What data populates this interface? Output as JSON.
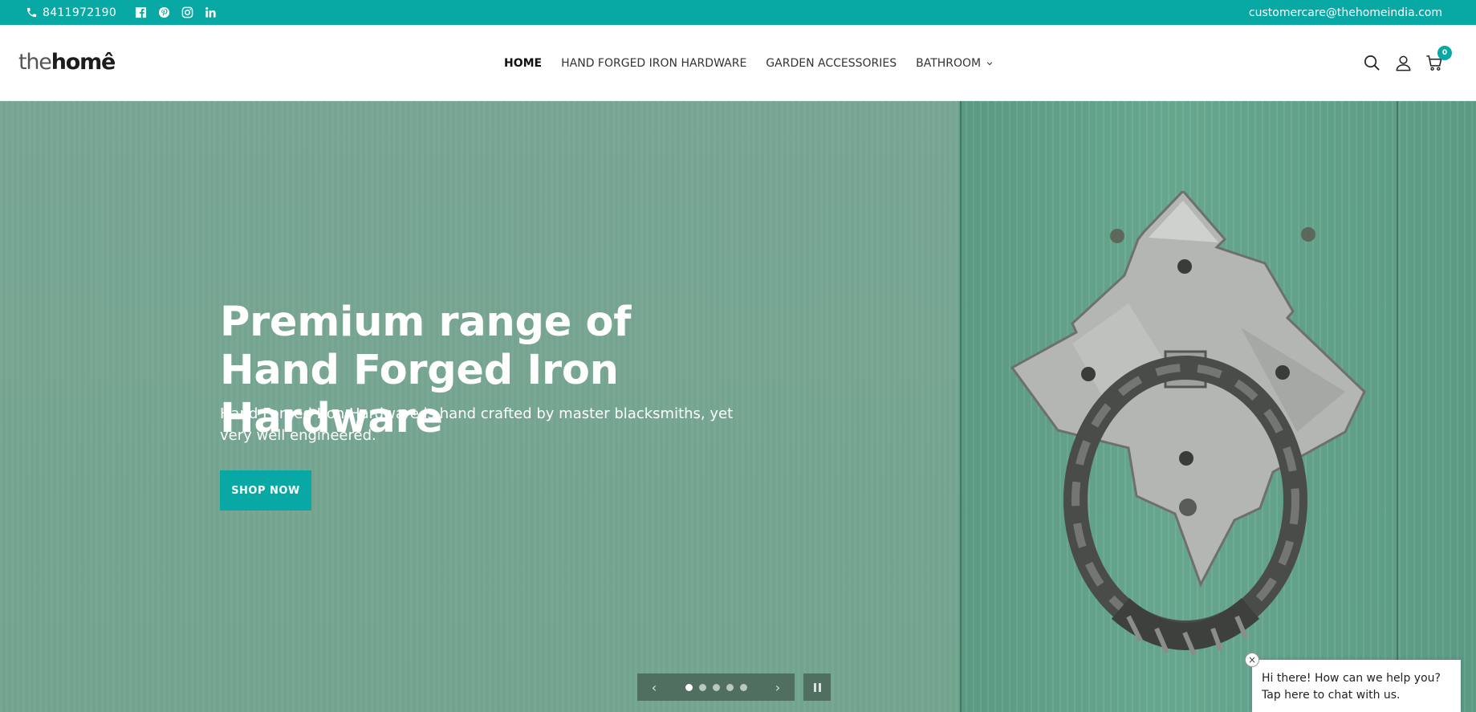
{
  "topbar": {
    "phone": "8411972190",
    "social_icons": [
      "facebook-icon",
      "pinterest-icon",
      "instagram-icon",
      "linkedin-icon"
    ],
    "email": "customercare@thehomeindia.com",
    "bg_color": "#08a9a5"
  },
  "header": {
    "logo": {
      "the": "the",
      "home": "homê"
    },
    "nav": [
      {
        "label": "HOME",
        "active": true
      },
      {
        "label": "HAND FORGED IRON HARDWARE"
      },
      {
        "label": "GARDEN ACCESSORIES"
      },
      {
        "label": "BATHROOM",
        "has_dropdown": true
      }
    ],
    "icons": [
      "search-icon",
      "account-icon",
      "cart-icon"
    ],
    "cart_count": "0"
  },
  "hero": {
    "headline": "Premium range of Hand Forged Iron Hardware",
    "subtext": "Hand Forged Iron Hardware is hand crafted by master blacksmiths, yet very well engineered.",
    "cta": "SHOP NOW",
    "slides_total": 5,
    "current_slide": 1
  },
  "slider_controls": {
    "prev": "‹",
    "next": "›"
  },
  "chat": {
    "message": "Hi there! How can we help you? Tap here to chat with us.",
    "close": "×"
  }
}
